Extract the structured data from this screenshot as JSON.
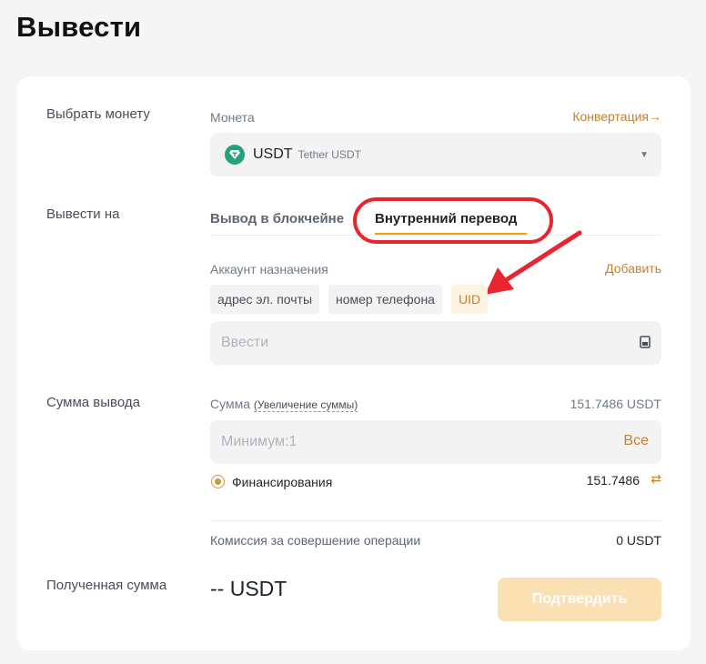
{
  "page": {
    "title": "Вывести"
  },
  "coin": {
    "section_label": "Выбрать монету",
    "field_label": "Монета",
    "convert_link": "Конвертация→",
    "selected_symbol": "USDT",
    "selected_name": "Tether USDT"
  },
  "destination": {
    "section_label": "Вывести на",
    "tabs": [
      {
        "label": "Вывод в блокчейне"
      },
      {
        "label": "Внутренний перевод"
      }
    ],
    "active_tab": 1,
    "account_label": "Аккаунт назначения",
    "add_link": "Добавить",
    "account_types": [
      {
        "label": "адрес эл. почты"
      },
      {
        "label": "номер телефона"
      },
      {
        "label": "UID"
      }
    ],
    "input_placeholder": "Ввести"
  },
  "amount": {
    "section_label": "Сумма вывода",
    "field_label": "Сумма",
    "increase_link": "(Увеличение суммы)",
    "available": "151.7486 USDT",
    "input_placeholder": "Минимум:1",
    "all_button": "Все",
    "funding_label": "Финансирования",
    "funding_value": "151.7486"
  },
  "fee": {
    "label": "Комиссия за совершение операции",
    "value": "0 USDT"
  },
  "received": {
    "label": "Полученная сумма",
    "value": "-- USDT"
  },
  "confirm_button": "Подтвердить",
  "colors": {
    "accent": "#c77f2a",
    "tab_underline": "#f0a010",
    "annotation_red": "#e8252e",
    "confirm_disabled": "#fbe0b4",
    "coin_green": "#26a17b"
  }
}
